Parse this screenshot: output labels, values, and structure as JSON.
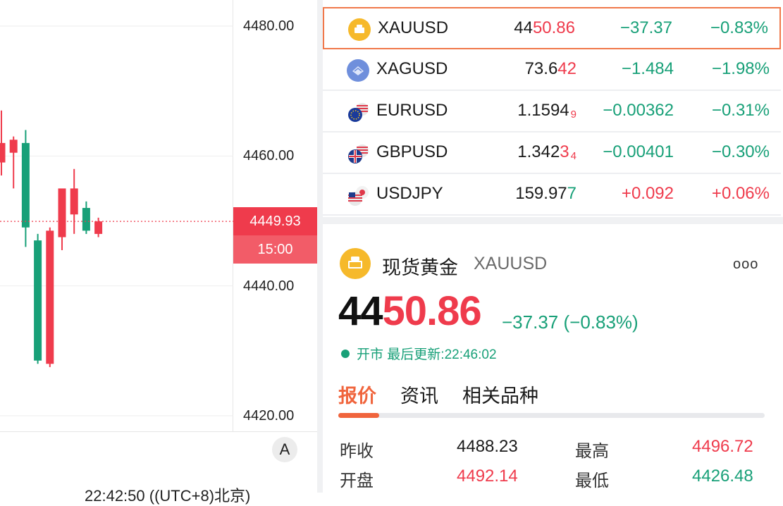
{
  "chart": {
    "y_ticks": [
      "4480.00",
      "4460.00",
      "4440.00",
      "4420.00"
    ],
    "current_price_tag": "4449.93",
    "countdown_tag": "15:00",
    "scale_button": "A",
    "bottom_time_text": "22:42:50 ((UTC+8)北京)",
    "colors": {
      "up": "#ef3b4c",
      "down": "#18a078"
    },
    "candles": [
      {
        "o": 4459.0,
        "h": 4467.0,
        "l": 4457.0,
        "c": 4462.0
      },
      {
        "o": 4460.5,
        "h": 4463.0,
        "l": 4455.0,
        "c": 4462.5
      },
      {
        "o": 4462.0,
        "h": 4464.0,
        "l": 4446.0,
        "c": 4449.0
      },
      {
        "o": 4447.0,
        "h": 4448.0,
        "l": 4428.0,
        "c": 4428.5
      },
      {
        "o": 4428.0,
        "h": 4449.0,
        "l": 4427.5,
        "c": 4448.5
      },
      {
        "o": 4447.5,
        "h": 4454.0,
        "l": 4445.5,
        "c": 4455.0
      },
      {
        "o": 4451.0,
        "h": 4458.0,
        "l": 4448.0,
        "c": 4455.0
      },
      {
        "o": 4452.0,
        "h": 4453.0,
        "l": 4448.0,
        "c": 4448.5
      },
      {
        "o": 4448.0,
        "h": 4450.5,
        "l": 4447.5,
        "c": 4449.93
      }
    ]
  },
  "watchlist": [
    {
      "symbol": "XAUUSD",
      "price_a": "44",
      "price_b": "50.86",
      "price_b_color": "red",
      "price_sub": "",
      "change": "−37.37",
      "change_color": "green",
      "pct": "−0.83%",
      "pct_color": "green",
      "icon": "gold-icon",
      "selected": true
    },
    {
      "symbol": "XAGUSD",
      "price_a": "73.6",
      "price_b": "42",
      "price_b_color": "red",
      "price_sub": "",
      "change": "−1.484",
      "change_color": "green",
      "pct": "−1.98%",
      "pct_color": "green",
      "icon": "silver-icon",
      "selected": false
    },
    {
      "symbol": "EURUSD",
      "price_a": "1.1594",
      "price_b": "",
      "price_b_color": "red",
      "price_sub": "9",
      "change": "−0.00362",
      "change_color": "green",
      "pct": "−0.31%",
      "pct_color": "green",
      "icon": "eu-us-flag-icon",
      "selected": false
    },
    {
      "symbol": "GBPUSD",
      "price_a": "1.342",
      "price_b": "3",
      "price_b_color": "red",
      "price_sub": "4",
      "change": "−0.00401",
      "change_color": "green",
      "pct": "−0.30%",
      "pct_color": "green",
      "icon": "gb-us-flag-icon",
      "selected": false
    },
    {
      "symbol": "USDJPY",
      "price_a": "159.97",
      "price_b": "7",
      "price_b_color": "green",
      "price_sub": "",
      "change": "+0.092",
      "change_color": "red",
      "pct": "+0.06%",
      "pct_color": "red",
      "icon": "us-jp-flag-icon",
      "selected": false
    }
  ],
  "detail": {
    "name": "现货黄金",
    "code": "XAUUSD",
    "more": "ooo",
    "price_a": "44",
    "price_b": "50.86",
    "change_text": "−37.37 (−0.83%)",
    "status": "开市",
    "last_update": "最后更新:22:46:02",
    "tabs": [
      "报价",
      "资讯",
      "相关品种"
    ],
    "stats": [
      {
        "label1": "昨收",
        "val1": "4488.23",
        "val1_color": "dark",
        "label2": "最高",
        "val2": "4496.72",
        "val2_color": "red"
      },
      {
        "label1": "开盘",
        "val1": "4492.14",
        "val1_color": "red",
        "label2": "最低",
        "val2": "4426.48",
        "val2_color": "green"
      }
    ]
  }
}
